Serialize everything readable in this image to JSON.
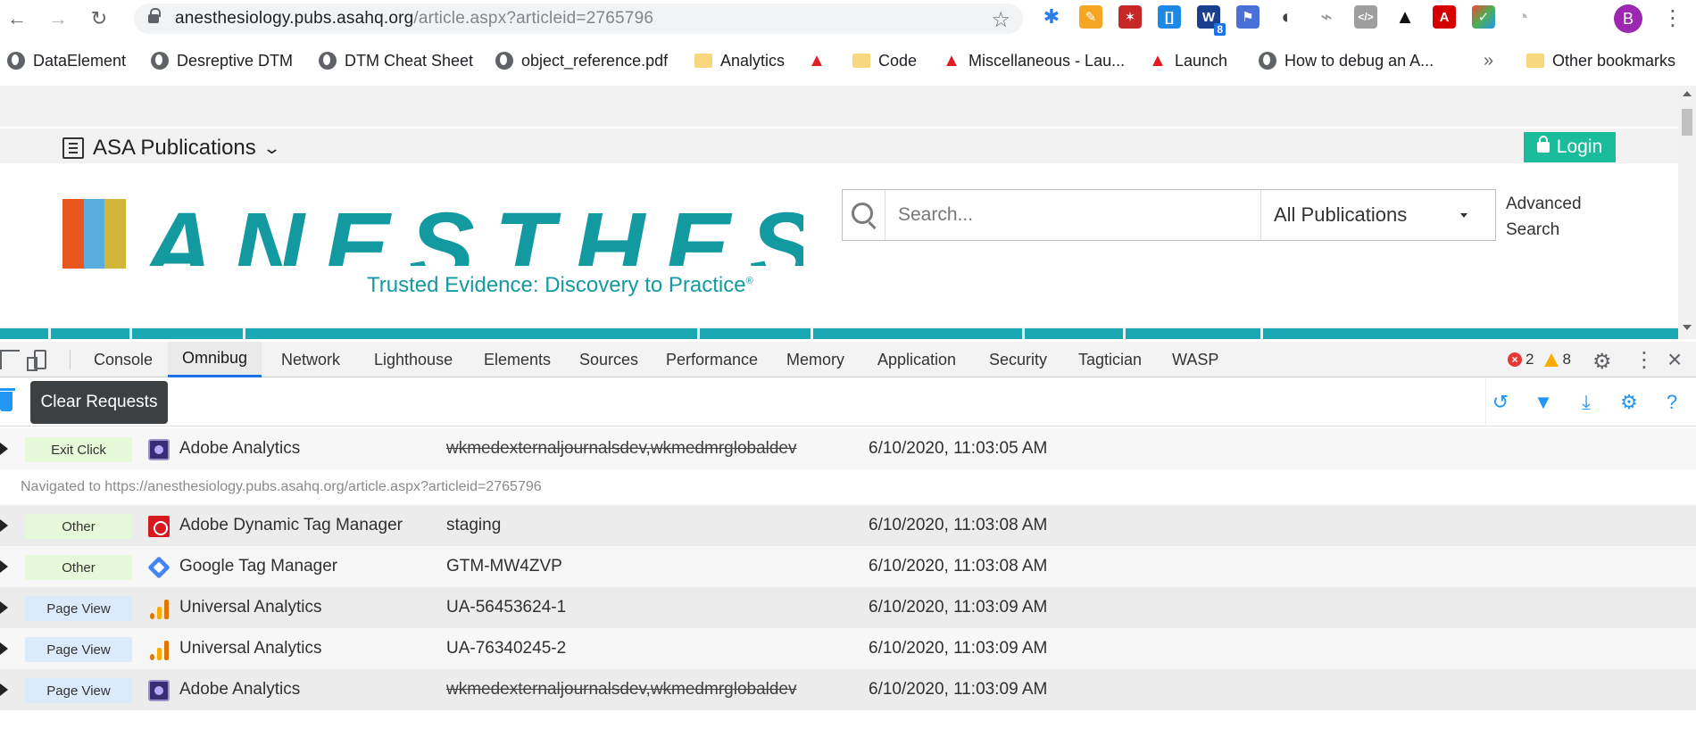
{
  "browser": {
    "url_host": "anesthesiology.pubs.asahq.org",
    "url_path": "/article.aspx?articleid=2765796",
    "profile_initial": "B",
    "extension_badge": "8"
  },
  "bookmarks": [
    {
      "label": "DataElement",
      "icon": "globe-icon"
    },
    {
      "label": "Desreptive DTM",
      "icon": "globe-icon"
    },
    {
      "label": "DTM Cheat Sheet",
      "icon": "globe-icon"
    },
    {
      "label": "object_reference.pdf",
      "icon": "globe-icon"
    },
    {
      "label": "Analytics",
      "icon": "folder-icon"
    },
    {
      "label": "Code",
      "icon": "folder-icon"
    },
    {
      "label": "Miscellaneous - Lau...",
      "icon": "adobe-icon"
    },
    {
      "label": "Launch",
      "icon": "adobe-icon"
    },
    {
      "label": "How to debug an A...",
      "icon": "globe-icon"
    },
    {
      "label": "Other bookmarks",
      "icon": "folder-icon"
    }
  ],
  "bookmarks_overflow": "»",
  "site": {
    "publications_label": "ASA Publications",
    "login_label": "Login",
    "logo_text": "ANESTHESIOLOGY",
    "tagline": "Trusted Evidence: Discovery to Practice",
    "tagline_mark": "®",
    "search_placeholder": "Search...",
    "publication_filter": "All Publications",
    "advanced_search": "Advanced Search",
    "brand_colors": {
      "orange": "#e9561e",
      "blue": "#5aaede",
      "gold": "#d2b63a",
      "teal": "#139aa0",
      "login": "#1abc9c"
    }
  },
  "devtools": {
    "tabs": [
      "Console",
      "Omnibug",
      "Network",
      "Lighthouse",
      "Elements",
      "Sources",
      "Performance",
      "Memory",
      "Application",
      "Security",
      "Tagtician",
      "WASP"
    ],
    "active_tab": "Omnibug",
    "error_count": "2",
    "warning_count": "8"
  },
  "omnibug": {
    "tooltip": "Clear Requests",
    "navigation_message": "Navigated to https://anesthesiology.pubs.asahq.org/article.aspx?articleid=2765796",
    "requests": [
      {
        "type": "Exit Click",
        "type_color": "green",
        "service": "Adobe Analytics",
        "icon": "adobe-analytics-icon",
        "account": "wkmedexternaljournalsdev,wkmedmrglobaldev",
        "timestamp": "6/10/2020, 11:03:05 AM"
      },
      {
        "type": "Other",
        "type_color": "green",
        "service": "Adobe Dynamic Tag Manager",
        "icon": "adobe-dtm-icon",
        "account": "staging",
        "timestamp": "6/10/2020, 11:03:08 AM"
      },
      {
        "type": "Other",
        "type_color": "green",
        "service": "Google Tag Manager",
        "icon": "google-tag-manager-icon",
        "account": "GTM-MW4ZVP",
        "timestamp": "6/10/2020, 11:03:08 AM"
      },
      {
        "type": "Page View",
        "type_color": "blue",
        "service": "Universal Analytics",
        "icon": "universal-analytics-icon",
        "account": "UA-56453624-1",
        "timestamp": "6/10/2020, 11:03:09 AM"
      },
      {
        "type": "Page View",
        "type_color": "blue",
        "service": "Universal Analytics",
        "icon": "universal-analytics-icon",
        "account": "UA-76340245-2",
        "timestamp": "6/10/2020, 11:03:09 AM"
      },
      {
        "type": "Page View",
        "type_color": "blue",
        "service": "Adobe Analytics",
        "icon": "adobe-analytics-icon",
        "account": "wkmedexternaljournalsdev,wkmedmrglobaldev",
        "timestamp": "6/10/2020, 11:03:09 AM"
      }
    ]
  }
}
